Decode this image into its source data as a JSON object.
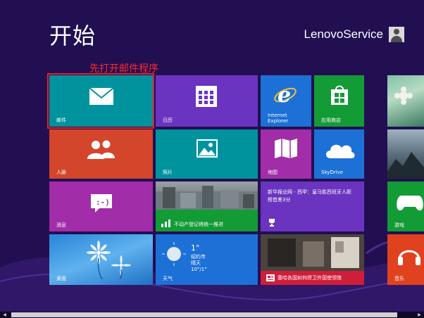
{
  "start": {
    "title": "开始"
  },
  "user": {
    "name": "LenovoService"
  },
  "annotation": {
    "text": "先打开邮件程序"
  },
  "tiles": {
    "mail": {
      "label": "邮件",
      "color": "#00939e",
      "icon": "mail-icon"
    },
    "calendar": {
      "label": "日历",
      "color": "#6b34c0",
      "icon": "calendar-icon"
    },
    "ie": {
      "label_line1": "Internet",
      "label_line2": "Explorer",
      "color": "#1c70d6",
      "icon": "internet-explorer-icon"
    },
    "store": {
      "label": "应用商店",
      "color": "#139b35",
      "icon": "store-icon"
    },
    "people": {
      "label": "人脉",
      "color": "#d3462b",
      "icon": "people-icon"
    },
    "photos": {
      "label": "照片",
      "color": "#00939e",
      "icon": "photos-icon"
    },
    "maps": {
      "label": "地图",
      "color": "#a22da8",
      "icon": "maps-icon"
    },
    "skydrive": {
      "label": "SkyDrive",
      "color": "#1c70d6",
      "icon": "cloud-icon"
    },
    "messaging": {
      "label": "消息",
      "color": "#a22da8",
      "icon": "messaging-icon"
    },
    "finance": {
      "label": "不动产登记将统一推进",
      "color": "#139b35",
      "icon": "chart-icon"
    },
    "sports": {
      "headline_line1": "新华报业网 - 西甲：皇马胜西班牙人距",
      "headline_line2": "榜首差3分",
      "color": "#6b34c0",
      "icon": "trophy-icon"
    },
    "games": {
      "label": "游戏",
      "color": "#139b35",
      "icon": "controller-icon"
    },
    "desktop": {
      "label": "桌面",
      "color": "#1c70d6"
    },
    "weather": {
      "temp": "1°",
      "city": "绍约市",
      "condition": "晴天",
      "range": "10°/1°",
      "label": "天气",
      "color": "#1c70d6"
    },
    "news": {
      "label": "塞哈各国如何捍卫外国使领馆",
      "color": "#cf1e3a",
      "icon": "news-icon"
    },
    "music": {
      "label": "音乐",
      "color": "#e0411f",
      "icon": "headphones-icon"
    }
  }
}
